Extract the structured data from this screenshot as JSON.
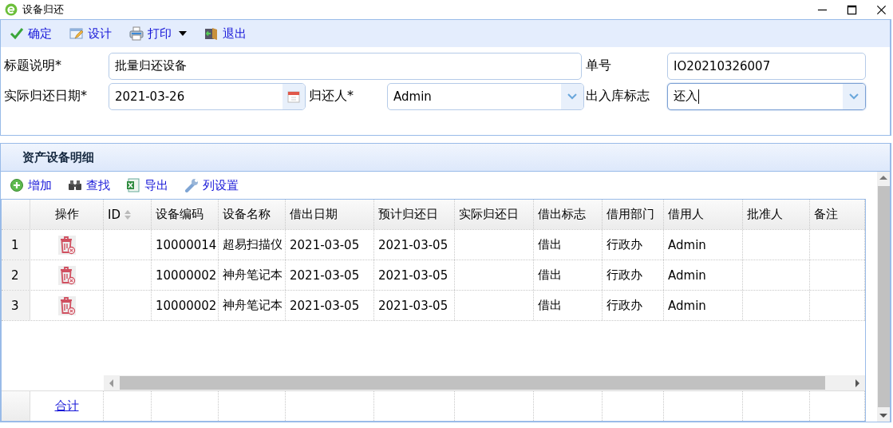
{
  "window": {
    "title": "设备归还"
  },
  "toolbar": [
    {
      "label": "确定",
      "kind": "confirm"
    },
    {
      "label": "设计",
      "kind": "design"
    },
    {
      "label": "打印",
      "kind": "print",
      "dropdown": true
    },
    {
      "label": "退出",
      "kind": "exit"
    }
  ],
  "form": {
    "fields": [
      {
        "label": "标题说明*",
        "value": "批量归还设备",
        "kind": "text",
        "focused": false
      },
      {
        "label": "单号",
        "value": "IO20210326007",
        "kind": "text",
        "focused": false
      },
      {
        "label": "实际归还日期*",
        "value": "2021-03-26",
        "kind": "date",
        "focused": false
      },
      {
        "label": "归还人*",
        "value": "Admin",
        "kind": "combo",
        "focused": false
      },
      {
        "label": "出入库标志",
        "value": "还入",
        "kind": "combo",
        "focused": true
      }
    ]
  },
  "detail": {
    "title": "资产设备明细",
    "toolbar": [
      {
        "label": "增加",
        "kind": "add"
      },
      {
        "label": "查找",
        "kind": "find"
      },
      {
        "label": "导出",
        "kind": "export"
      },
      {
        "label": "列设置",
        "kind": "columns"
      }
    ],
    "columns": [
      {
        "label": "操作",
        "sortable": false
      },
      {
        "label": "ID",
        "sortable": true
      },
      {
        "label": "设备编码",
        "sortable": false
      },
      {
        "label": "设备名称",
        "sortable": false
      },
      {
        "label": "借出日期",
        "sortable": false
      },
      {
        "label": "预计归还日",
        "sortable": false
      },
      {
        "label": "实际归还日",
        "sortable": false
      },
      {
        "label": "借出标志",
        "sortable": false
      },
      {
        "label": "借用部门",
        "sortable": false
      },
      {
        "label": "借用人",
        "sortable": false
      },
      {
        "label": "批准人",
        "sortable": false
      },
      {
        "label": "备注",
        "sortable": false
      }
    ],
    "rows": [
      {
        "num": "1",
        "cells": [
          "",
          "",
          "10000014",
          "超易扫描仪",
          "2021-03-05",
          "2021-03-05",
          "",
          "借出",
          "行政办",
          "Admin",
          "",
          ""
        ]
      },
      {
        "num": "2",
        "cells": [
          "",
          "",
          "10000002",
          "神舟笔记本",
          "2021-03-05",
          "2021-03-05",
          "",
          "借出",
          "行政办",
          "Admin",
          "",
          ""
        ]
      },
      {
        "num": "3",
        "cells": [
          "",
          "",
          "10000002",
          "神舟笔记本",
          "2021-03-05",
          "2021-03-05",
          "",
          "借出",
          "行政办",
          "Admin",
          "",
          ""
        ]
      }
    ],
    "footer": {
      "label": "合计"
    }
  }
}
